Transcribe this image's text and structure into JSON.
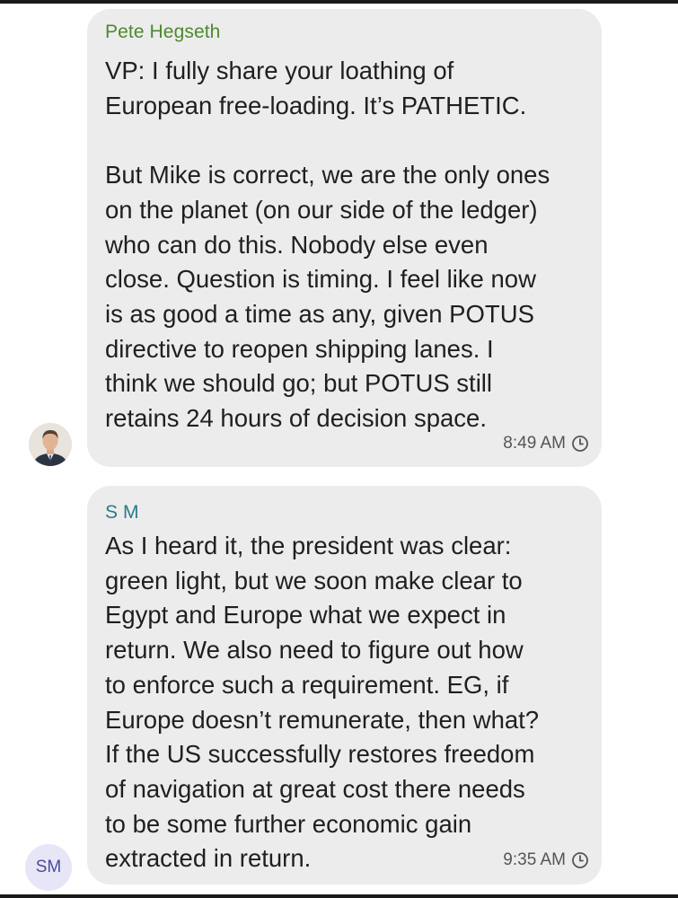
{
  "colors": {
    "sender1_name": "#4c8a2c",
    "sender2_name": "#2a7a8a",
    "bubble_bg": "#ececec",
    "initials_avatar_bg": "#e6e6f7",
    "initials_avatar_text": "#4a4a9c"
  },
  "messages": [
    {
      "sender": "Pete Hegseth",
      "avatar": "profile-photo",
      "lines": [
        "VP: I fully share your loathing of",
        "European free-loading. It’s PATHETIC.",
        "",
        "But Mike is correct, we are the only ones",
        "on the planet (on our side of the ledger)",
        "who can do this. Nobody else even",
        "close. Question is timing. I feel like now",
        "is as good a time as any, given POTUS",
        "directive to reopen shipping lanes. I",
        "think we should go; but POTUS still",
        "retains 24 hours of decision space."
      ],
      "time": "8:49 AM",
      "status_icon": "clock-icon"
    },
    {
      "sender": "S M",
      "avatar_initials": "SM",
      "lines": [
        "As I heard it, the president was clear:",
        "green light, but we soon make clear to",
        "Egypt and Europe what we expect in",
        "return. We also need to figure out how",
        "to enforce such a requirement. EG, if",
        "Europe doesn’t remunerate, then what?",
        "If the US successfully restores freedom",
        "of navigation at great cost there needs",
        "to be some further economic gain",
        "extracted in return."
      ],
      "time": "9:35 AM",
      "status_icon": "clock-icon"
    }
  ]
}
